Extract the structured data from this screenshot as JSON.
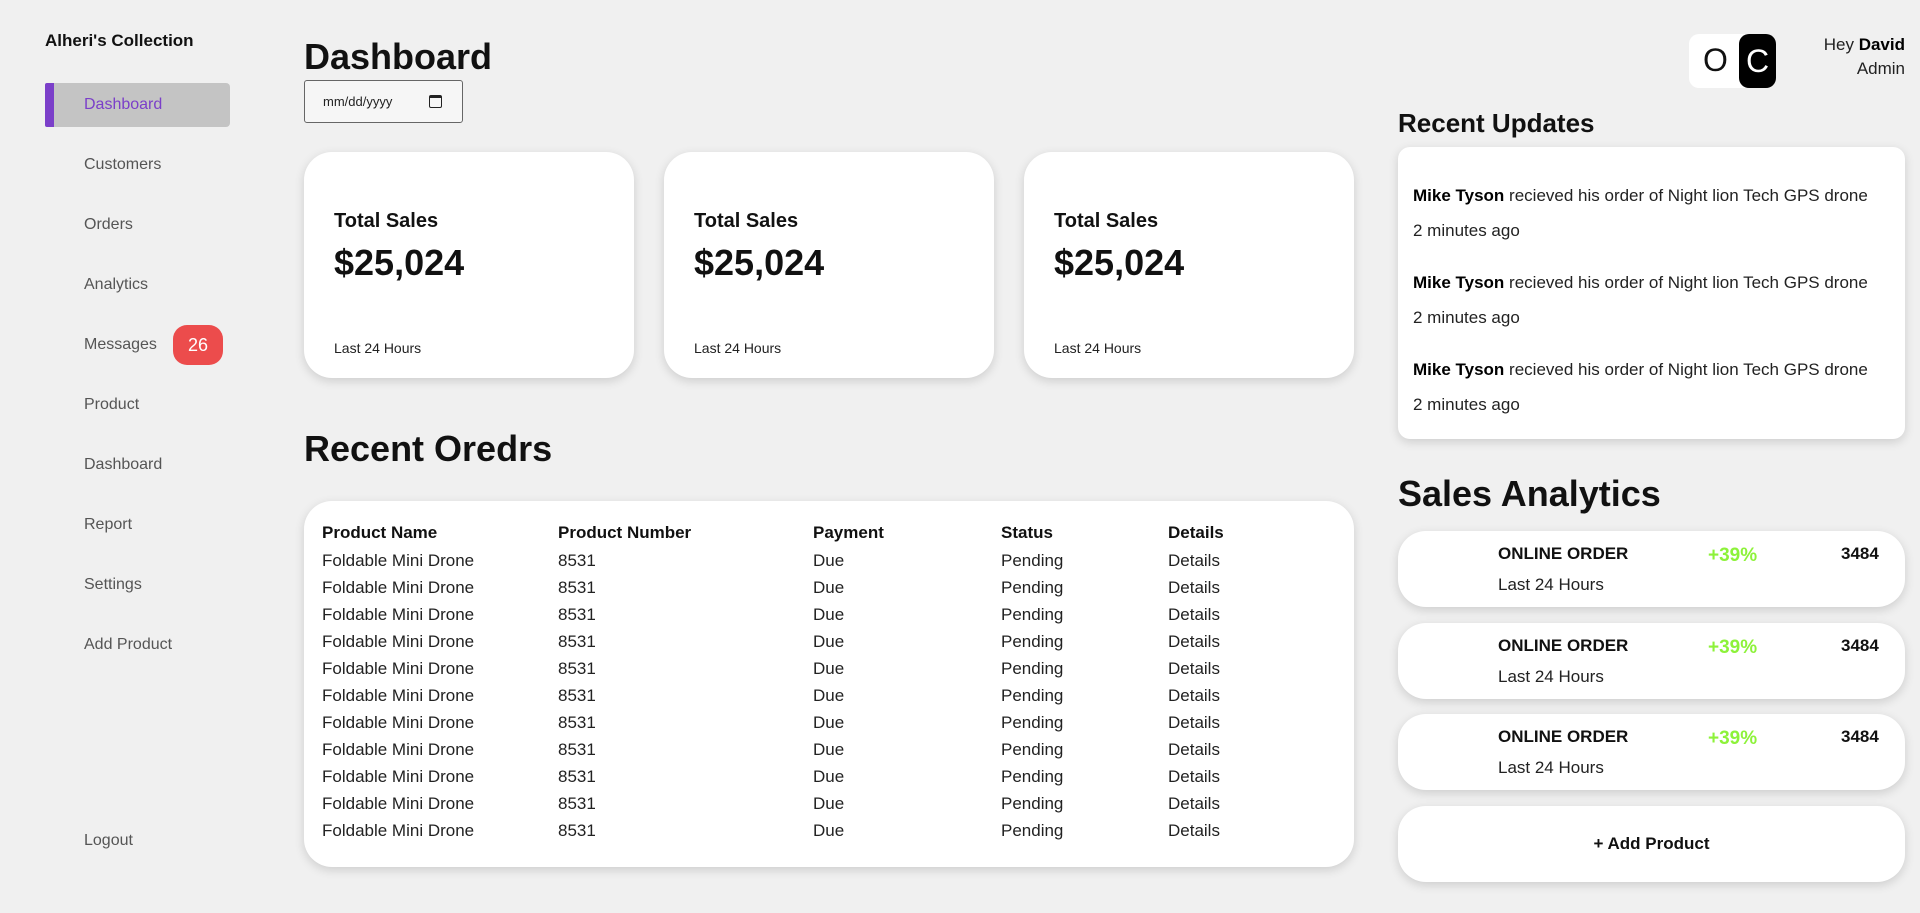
{
  "sidebar": {
    "brand": "Alheri's Collection",
    "items": [
      {
        "label": "Dashboard",
        "active": true
      },
      {
        "label": "Customers"
      },
      {
        "label": "Orders"
      },
      {
        "label": "Analytics"
      },
      {
        "label": "Messages",
        "badge": "26"
      },
      {
        "label": "Product"
      },
      {
        "label": "Dashboard"
      },
      {
        "label": "Report"
      },
      {
        "label": "Settings"
      },
      {
        "label": "Add Product"
      }
    ],
    "logout": "Logout"
  },
  "main": {
    "title": "Dashboard",
    "date_placeholder": "mm/dd/yyyy",
    "cards": [
      {
        "title": "Total Sales",
        "value": "$25,024",
        "note": "Last 24 Hours"
      },
      {
        "title": "Total Sales",
        "value": "$25,024",
        "note": "Last 24 Hours"
      },
      {
        "title": "Total Sales",
        "value": "$25,024",
        "note": "Last 24 Hours"
      }
    ],
    "orders_title": "Recent Oredrs",
    "orders": {
      "columns": [
        "Product Name",
        "Product Number",
        "Payment",
        "Status",
        "Details"
      ],
      "rows": [
        [
          "Foldable Mini Drone",
          "8531",
          "Due",
          "Pending",
          "Details"
        ],
        [
          "Foldable Mini Drone",
          "8531",
          "Due",
          "Pending",
          "Details"
        ],
        [
          "Foldable Mini Drone",
          "8531",
          "Due",
          "Pending",
          "Details"
        ],
        [
          "Foldable Mini Drone",
          "8531",
          "Due",
          "Pending",
          "Details"
        ],
        [
          "Foldable Mini Drone",
          "8531",
          "Due",
          "Pending",
          "Details"
        ],
        [
          "Foldable Mini Drone",
          "8531",
          "Due",
          "Pending",
          "Details"
        ],
        [
          "Foldable Mini Drone",
          "8531",
          "Due",
          "Pending",
          "Details"
        ],
        [
          "Foldable Mini Drone",
          "8531",
          "Due",
          "Pending",
          "Details"
        ],
        [
          "Foldable Mini Drone",
          "8531",
          "Due",
          "Pending",
          "Details"
        ],
        [
          "Foldable Mini Drone",
          "8531",
          "Due",
          "Pending",
          "Details"
        ],
        [
          "Foldable Mini Drone",
          "8531",
          "Due",
          "Pending",
          "Details"
        ]
      ]
    }
  },
  "header": {
    "toggle_light": "O",
    "toggle_dark": "C",
    "greeting_prefix": "Hey",
    "user_name": "David",
    "role": "Admin"
  },
  "updates": {
    "title": "Recent Updates",
    "items": [
      {
        "name": "Mike Tyson",
        "text": " recieved his order of Night lion Tech GPS drone",
        "time": "2 minutes ago"
      },
      {
        "name": "Mike Tyson",
        "text": " recieved his order of Night lion Tech GPS drone",
        "time": "2 minutes ago"
      },
      {
        "name": "Mike Tyson",
        "text": " recieved his order of Night lion Tech GPS drone",
        "time": "2 minutes ago"
      }
    ]
  },
  "analytics": {
    "title": "Sales Analytics",
    "items": [
      {
        "title": "ONLINE ORDER",
        "sub": "Last 24 Hours",
        "pct": "+39%",
        "num": "3484"
      },
      {
        "title": "ONLINE ORDER",
        "sub": "Last 24 Hours",
        "pct": "+39%",
        "num": "3484"
      },
      {
        "title": "ONLINE ORDER",
        "sub": "Last 24 Hours",
        "pct": "+39%",
        "num": "3484"
      }
    ],
    "add_product": "+ Add Product"
  },
  "colors": {
    "accent": "#7b3fc9",
    "badge": "#ec4c4c",
    "positive": "#8df23a",
    "background": "#f0f0f0"
  }
}
